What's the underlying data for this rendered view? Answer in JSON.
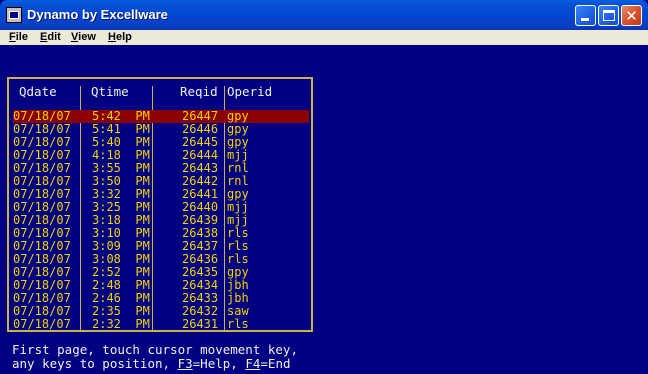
{
  "window": {
    "title": "Dynamo by Excellware",
    "close_glyph": "✕"
  },
  "menu": {
    "items": [
      "File",
      "Edit",
      "View",
      "Help"
    ],
    "underlines": [
      "F",
      "E",
      "V",
      "H"
    ]
  },
  "table": {
    "headers": {
      "qdate": "Qdate",
      "qtime": "Qtime",
      "reqid": "Reqid",
      "operid": "Operid"
    },
    "selected_index": 0,
    "rows": [
      {
        "qdate": "07/18/07",
        "qtime": "5:42  PM",
        "reqid": "26447",
        "operid": "gpy"
      },
      {
        "qdate": "07/18/07",
        "qtime": "5:41  PM",
        "reqid": "26446",
        "operid": "gpy"
      },
      {
        "qdate": "07/18/07",
        "qtime": "5:40  PM",
        "reqid": "26445",
        "operid": "gpy"
      },
      {
        "qdate": "07/18/07",
        "qtime": "4:18  PM",
        "reqid": "26444",
        "operid": "mjj"
      },
      {
        "qdate": "07/18/07",
        "qtime": "3:55  PM",
        "reqid": "26443",
        "operid": "rnl"
      },
      {
        "qdate": "07/18/07",
        "qtime": "3:50  PM",
        "reqid": "26442",
        "operid": "rnl"
      },
      {
        "qdate": "07/18/07",
        "qtime": "3:32  PM",
        "reqid": "26441",
        "operid": "gpy"
      },
      {
        "qdate": "07/18/07",
        "qtime": "3:25  PM",
        "reqid": "26440",
        "operid": "mjj"
      },
      {
        "qdate": "07/18/07",
        "qtime": "3:18  PM",
        "reqid": "26439",
        "operid": "mjj"
      },
      {
        "qdate": "07/18/07",
        "qtime": "3:10  PM",
        "reqid": "26438",
        "operid": "rls"
      },
      {
        "qdate": "07/18/07",
        "qtime": "3:09  PM",
        "reqid": "26437",
        "operid": "rls"
      },
      {
        "qdate": "07/18/07",
        "qtime": "3:08  PM",
        "reqid": "26436",
        "operid": "rls"
      },
      {
        "qdate": "07/18/07",
        "qtime": "2:52  PM",
        "reqid": "26435",
        "operid": "gpy"
      },
      {
        "qdate": "07/18/07",
        "qtime": "2:48  PM",
        "reqid": "26434",
        "operid": "jbh"
      },
      {
        "qdate": "07/18/07",
        "qtime": "2:46  PM",
        "reqid": "26433",
        "operid": "jbh"
      },
      {
        "qdate": "07/18/07",
        "qtime": "2:35  PM",
        "reqid": "26432",
        "operid": "saw"
      },
      {
        "qdate": "07/18/07",
        "qtime": "2:32  PM",
        "reqid": "26431",
        "operid": "rls"
      }
    ]
  },
  "help": {
    "line1": "First page, touch cursor movement key,",
    "line2_a": "any keys to position, ",
    "f3_key": "F3",
    "line2_b": "=Help, ",
    "f4_key": "F4",
    "line2_c": "=End"
  },
  "colors": {
    "background": "#000080",
    "text": "#f5d300",
    "border": "#c9b24a",
    "selection": "#8b0000"
  }
}
